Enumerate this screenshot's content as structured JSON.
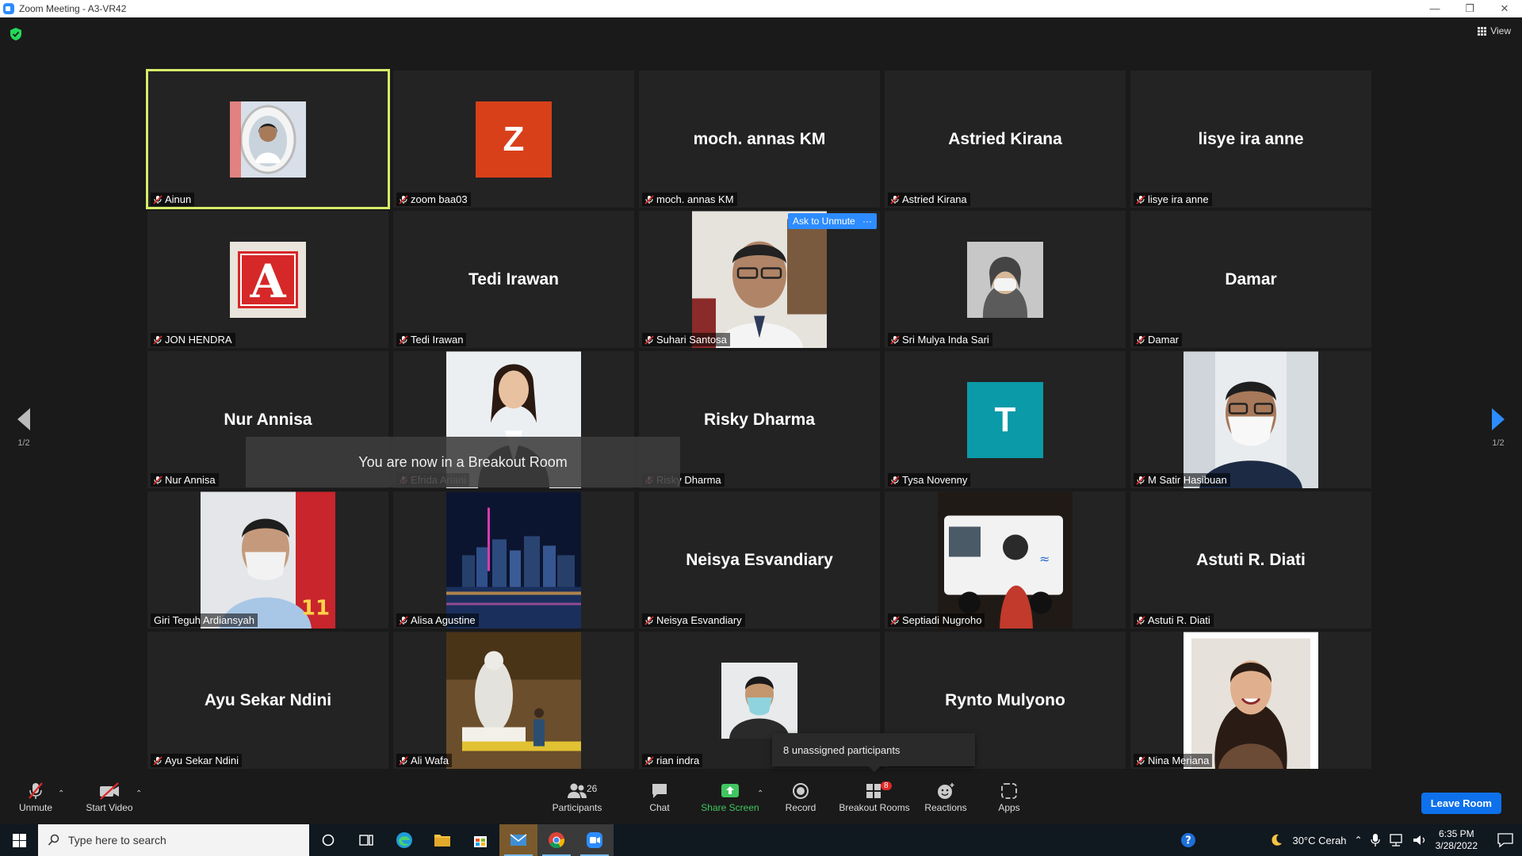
{
  "window": {
    "title": "Zoom Meeting - A3-VR42"
  },
  "header": {
    "view_label": "View"
  },
  "tiles": [
    {
      "name": "Ainun",
      "type": "photo",
      "photo_icon": "woman-photo",
      "active": true
    },
    {
      "name": "zoom baa03",
      "type": "letter",
      "letter": "Z",
      "color": "#d8401a"
    },
    {
      "name": "moch. annas KM",
      "type": "text",
      "display": "moch. annas KM"
    },
    {
      "name": "Astried Kirana",
      "type": "text",
      "display": "Astried Kirana"
    },
    {
      "name": "lisye ira anne",
      "type": "text",
      "display": "lisye ira anne"
    },
    {
      "name": "JON HENDRA",
      "type": "photo",
      "photo_icon": "letter-a-logo"
    },
    {
      "name": "Tedi Irawan",
      "type": "text",
      "display": "Tedi Irawan"
    },
    {
      "name": "Suhari Santosa",
      "type": "video",
      "photo_icon": "man-glasses-video"
    },
    {
      "name": "Sri Mulya Inda Sari",
      "type": "photo",
      "photo_icon": "woman-mask-photo"
    },
    {
      "name": "Damar",
      "type": "text",
      "display": "Damar"
    },
    {
      "name": "Nur Annisa",
      "type": "text",
      "display": "Nur Annisa"
    },
    {
      "name": "Efrida Ariani",
      "type": "video",
      "photo_icon": "woman-suit-video"
    },
    {
      "name": "Risky Dharma",
      "type": "text",
      "display": "Risky Dharma"
    },
    {
      "name": "Tysa Novenny",
      "type": "letter",
      "letter": "T",
      "color": "#0b9aa8"
    },
    {
      "name": "M Satir Hasibuan",
      "type": "video",
      "photo_icon": "man-mask-video"
    },
    {
      "name": "Giri Teguh Ardiansyah",
      "type": "video",
      "photo_icon": "man-mask-poster-video",
      "no_mic": true
    },
    {
      "name": "Alisa Agustine",
      "type": "video",
      "photo_icon": "city-night-video"
    },
    {
      "name": "Neisya Esvandiary",
      "type": "text",
      "display": "Neisya Esvandiary"
    },
    {
      "name": "Septiadi Nugroho",
      "type": "video",
      "photo_icon": "truck-video"
    },
    {
      "name": "Astuti R. Diati",
      "type": "text",
      "display": "Astuti R. Diati"
    },
    {
      "name": "Ayu Sekar Ndini",
      "type": "text",
      "display": "Ayu Sekar Ndini"
    },
    {
      "name": "Ali Wafa",
      "type": "video",
      "photo_icon": "statue-cave-video"
    },
    {
      "name": "rian indra",
      "type": "photo",
      "photo_icon": "man-mask-photo"
    },
    {
      "name": "Rynto Mulyono",
      "type": "text",
      "display": "Rynto Mulyono"
    },
    {
      "name": "Nina Meriana",
      "type": "video",
      "photo_icon": "woman-smile-video"
    }
  ],
  "hover_controls": {
    "ask_to_unmute": "Ask to Unmute",
    "more": "···"
  },
  "overlay": {
    "breakout_message": "You are now in a Breakout Room",
    "unassigned_popup": "8 unassigned participants"
  },
  "pagination": {
    "left": "1/2",
    "right": "1/2"
  },
  "toolbar": {
    "unmute": "Unmute",
    "start_video": "Start Video",
    "participants": "Participants",
    "participants_count": "26",
    "chat": "Chat",
    "share_screen": "Share Screen",
    "record": "Record",
    "breakout_rooms": "Breakout Rooms",
    "breakout_badge": "8",
    "reactions": "Reactions",
    "apps": "Apps",
    "leave": "Leave Room"
  },
  "taskbar": {
    "search_placeholder": "Type here to search",
    "weather": "30°C  Cerah",
    "time": "6:35 PM",
    "date": "3/28/2022"
  },
  "colors": {
    "active_speaker": "#d5ec69",
    "accent_blue": "#2d8cff",
    "share_green": "#40c660",
    "muted_red": "#e02828"
  }
}
